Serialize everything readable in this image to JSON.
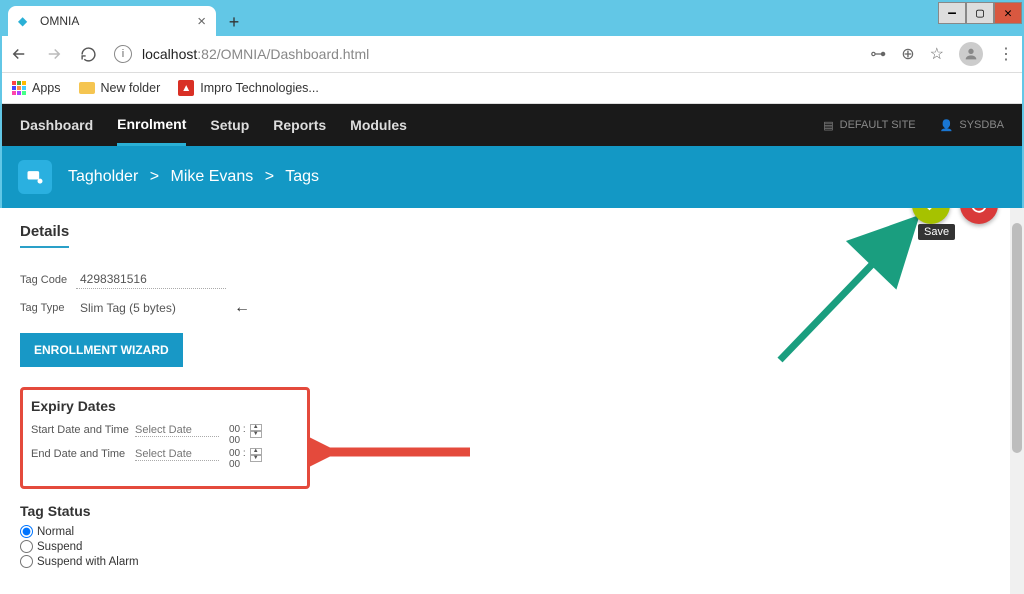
{
  "window": {
    "min": "—",
    "max": "▢",
    "close": "✕"
  },
  "browser": {
    "tab_title": "OMNIA",
    "url_host": "localhost",
    "url_port_path": ":82/OMNIA/Dashboard.html",
    "newtab": "+",
    "close_tab": "×"
  },
  "bookmarks": {
    "apps": "Apps",
    "newfolder": "New folder",
    "impro": "Impro Technologies..."
  },
  "nav": {
    "items": [
      "Dashboard",
      "Enrolment",
      "Setup",
      "Reports",
      "Modules"
    ],
    "active_index": 1,
    "site": "DEFAULT SITE",
    "user": "SYSDBA"
  },
  "breadcrumb": {
    "a": "Tagholder",
    "b": "Mike Evans",
    "c": "Tags",
    "sep": ">"
  },
  "actions": {
    "save_tooltip": "Save"
  },
  "details": {
    "title": "Details",
    "tag_code_label": "Tag Code",
    "tag_code": "4298381516",
    "tag_type_label": "Tag Type",
    "tag_type": "Slim Tag (5 bytes)",
    "wizard_btn": "ENROLLMENT WIZARD"
  },
  "expiry": {
    "title": "Expiry Dates",
    "start_label": "Start Date and Time",
    "end_label": "End Date and Time",
    "placeholder": "Select Date",
    "hh": "00",
    "mm": "00",
    "colon": ":"
  },
  "status": {
    "title": "Tag Status",
    "options": [
      "Normal",
      "Suspend",
      "Suspend with Alarm"
    ],
    "selected_index": 0
  }
}
